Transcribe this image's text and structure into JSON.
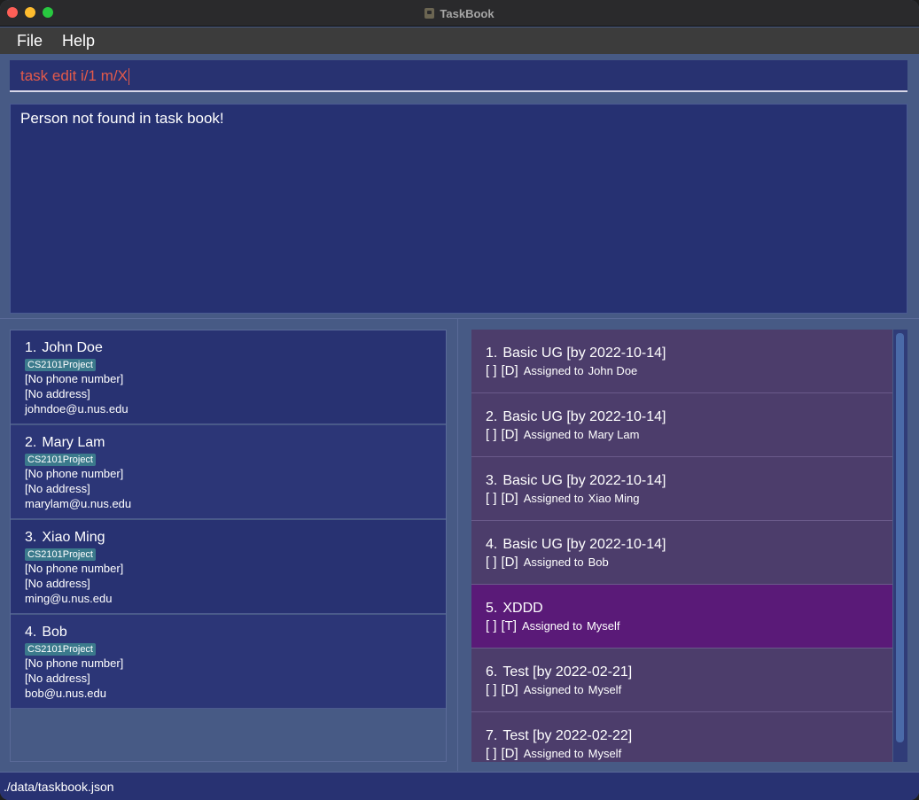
{
  "window": {
    "title": "TaskBook"
  },
  "menu": {
    "file": "File",
    "help": "Help"
  },
  "command": {
    "value": "task edit i/1 m/X"
  },
  "result": {
    "message": "Person not found in task book!"
  },
  "persons": [
    {
      "index": "1.",
      "name": "John Doe",
      "tag": "CS2101Project",
      "phone": "[No phone number]",
      "address": "[No address]",
      "email": "johndoe@u.nus.edu"
    },
    {
      "index": "2.",
      "name": "Mary Lam",
      "tag": "CS2101Project",
      "phone": "[No phone number]",
      "address": "[No address]",
      "email": "marylam@u.nus.edu"
    },
    {
      "index": "3.",
      "name": "Xiao Ming",
      "tag": "CS2101Project",
      "phone": "[No phone number]",
      "address": "[No address]",
      "email": "ming@u.nus.edu"
    },
    {
      "index": "4.",
      "name": "Bob",
      "tag": "CS2101Project",
      "phone": "[No phone number]",
      "address": "[No address]",
      "email": "bob@u.nus.edu"
    }
  ],
  "tasks": [
    {
      "index": "1.",
      "title": "Basic UG [by 2022-10-14]",
      "status": "[ ]",
      "type": "[D]",
      "assigned_label": "Assigned to",
      "assignee": "John Doe"
    },
    {
      "index": "2.",
      "title": "Basic UG [by 2022-10-14]",
      "status": "[ ]",
      "type": "[D]",
      "assigned_label": "Assigned to",
      "assignee": "Mary Lam"
    },
    {
      "index": "3.",
      "title": "Basic UG [by 2022-10-14]",
      "status": "[ ]",
      "type": "[D]",
      "assigned_label": "Assigned to",
      "assignee": "Xiao Ming"
    },
    {
      "index": "4.",
      "title": "Basic UG [by 2022-10-14]",
      "status": "[ ]",
      "type": "[D]",
      "assigned_label": "Assigned to",
      "assignee": "Bob"
    },
    {
      "index": "5.",
      "title": "XDDD",
      "status": "[ ]",
      "type": "[T]",
      "assigned_label": "Assigned to",
      "assignee": "Myself"
    },
    {
      "index": "6.",
      "title": "Test [by 2022-02-21]",
      "status": "[ ]",
      "type": "[D]",
      "assigned_label": "Assigned to",
      "assignee": "Myself"
    },
    {
      "index": "7.",
      "title": "Test [by 2022-02-22]",
      "status": "[ ]",
      "type": "[D]",
      "assigned_label": "Assigned to",
      "assignee": "Myself"
    }
  ],
  "status_bar": {
    "path": "./data/taskbook.json"
  },
  "colors": {
    "background": "#475a85",
    "card": "#283272",
    "task_card": "#4c3d6b",
    "task_selected": "#5a1a78",
    "command_text": "#e45a4a",
    "tag": "#3b7a8c"
  }
}
